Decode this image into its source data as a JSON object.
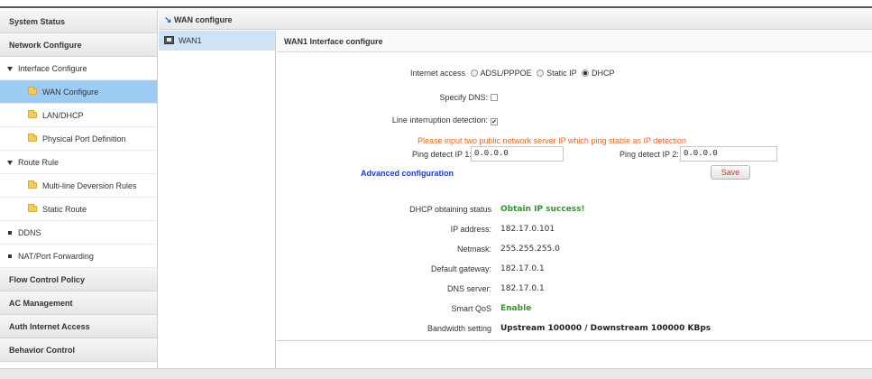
{
  "sidebar": {
    "items": [
      {
        "type": "section",
        "label": "System Status",
        "name": "sidebar-item-system-status"
      },
      {
        "type": "section",
        "label": "Network Configure",
        "name": "sidebar-item-network-configure"
      },
      {
        "type": "group",
        "label": "Interface Configure",
        "name": "sidebar-item-interface-configure"
      },
      {
        "type": "item",
        "label": "WAN Configure",
        "active": true,
        "name": "sidebar-item-wan-configure"
      },
      {
        "type": "item",
        "label": "LAN/DHCP",
        "name": "sidebar-item-lan-dhcp"
      },
      {
        "type": "item",
        "label": "Physical Port Definition",
        "name": "sidebar-item-physical-port-definition"
      },
      {
        "type": "group",
        "label": "Route Rule",
        "name": "sidebar-item-route-rule"
      },
      {
        "type": "item",
        "label": "Multi-line Deversion Rules",
        "name": "sidebar-item-multi-line-deversion-rules"
      },
      {
        "type": "item",
        "label": "Static Route",
        "name": "sidebar-item-static-route"
      },
      {
        "type": "bullet",
        "label": "DDNS",
        "name": "sidebar-item-ddns"
      },
      {
        "type": "bullet",
        "label": "NAT/Port Forwarding",
        "name": "sidebar-item-nat-port-forwarding"
      },
      {
        "type": "section",
        "label": "Flow Control Policy",
        "name": "sidebar-item-flow-control-policy"
      },
      {
        "type": "section",
        "label": "AC Management",
        "name": "sidebar-item-ac-management"
      },
      {
        "type": "section",
        "label": "Auth Internet Access",
        "name": "sidebar-item-auth-internet-access"
      },
      {
        "type": "section",
        "label": "Behavior Control",
        "name": "sidebar-item-behavior-control"
      }
    ]
  },
  "header": {
    "title": "WAN configure"
  },
  "wan_list": {
    "items": [
      {
        "label": "WAN1"
      }
    ]
  },
  "form": {
    "title": "WAN1 Interface configure",
    "internet_access_label": "Internet access",
    "options": [
      "ADSL/PPPOE",
      "Static IP",
      "DHCP"
    ],
    "selected": "DHCP",
    "specify_dns_label": "Specify DNS:",
    "specify_dns_checked": false,
    "line_interruption_label": "Line interruption detection:",
    "line_interruption_checked": true,
    "ping_hint": "Please input two public network server IP which ping stable as IP detection",
    "ping_ip1_label": "Ping detect IP 1:",
    "ping_ip1_value": "0.0.0.0",
    "ping_ip2_label": "Ping detect IP 2:",
    "ping_ip2_value": "0.0.0.0",
    "advanced_label": "Advanced configuration",
    "save_label": "Save"
  },
  "status": {
    "dhcp_label": "DHCP obtaining status",
    "dhcp_value": "Obtain IP success!",
    "ip_label": "IP address:",
    "ip_value": "182.17.0.101",
    "netmask_label": "Netmask:",
    "netmask_value": "255.255.255.0",
    "gateway_label": "Default gateway:",
    "gateway_value": "182.17.0.1",
    "dns_label": "DNS server:",
    "dns_value": "182.17.0.1",
    "qos_label": "Smart QoS",
    "qos_value": "Enable",
    "bandwidth_label": "Bandwidth setting",
    "bandwidth_value": "Upstream 100000 / Downstream 100000 KBps"
  },
  "colors": {
    "accent": "#9ccbf3",
    "success": "#2e9a2e",
    "warning": "#e26a2c",
    "link": "#1a3fc9"
  }
}
